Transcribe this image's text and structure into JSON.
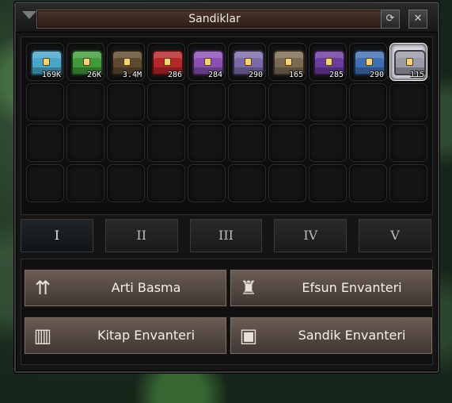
{
  "window": {
    "title": "Sandiklar"
  },
  "slots": [
    {
      "count": "169K",
      "color": "#4aa6c9",
      "icon": "ice-chest-icon"
    },
    {
      "count": "26K",
      "color": "#3f9a3a",
      "icon": "green-chest-icon"
    },
    {
      "count": "3.4M",
      "color": "#5d4a2e",
      "icon": "dark-chest-icon"
    },
    {
      "count": "286",
      "color": "#b3262a",
      "icon": "red-chest-icon"
    },
    {
      "count": "284",
      "color": "#8a4fb0",
      "icon": "purple-gold-chest-icon"
    },
    {
      "count": "290",
      "color": "#7c6aa8",
      "icon": "violet-chest-icon"
    },
    {
      "count": "165",
      "color": "#7a6a52",
      "icon": "skull-chest-icon"
    },
    {
      "count": "285",
      "color": "#6a3c9e",
      "icon": "purple-chest-icon"
    },
    {
      "count": "290",
      "color": "#3f6fb0",
      "icon": "blue-chest-icon"
    },
    {
      "count": "115",
      "color": "#9a9aa8",
      "icon": "silver-skull-chest-icon"
    }
  ],
  "tabs": [
    "I",
    "II",
    "III",
    "IV",
    "V"
  ],
  "buttons": {
    "arti_basma": "Arti Basma",
    "efsun_envanteri": "Efsun Envanteri",
    "kitap_envanteri": "Kitap Envanteri",
    "sandik_envanteri": "Sandik Envanteri"
  }
}
